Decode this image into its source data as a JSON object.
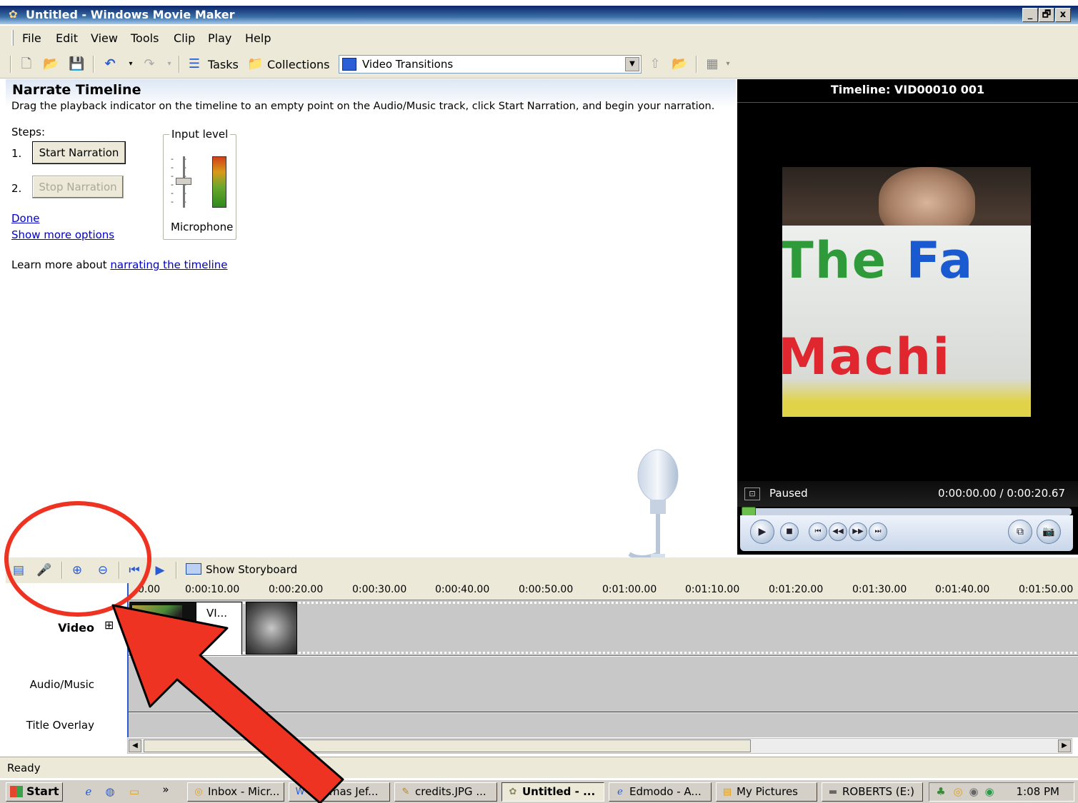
{
  "window": {
    "title": "Untitled - Windows Movie Maker",
    "controls": [
      "_",
      "🗗",
      "x"
    ]
  },
  "menu": [
    "File",
    "Edit",
    "View",
    "Tools",
    "Clip",
    "Play",
    "Help"
  ],
  "toolbar": {
    "tasks_label": "Tasks",
    "collections_label": "Collections",
    "dropdown_value": "Video Transitions"
  },
  "task_pane": {
    "title": "Narrate Timeline",
    "description": "Drag the playback indicator on the timeline to an empty point on the Audio/Music track, click Start Narration, and begin your narration.",
    "steps_label": "Steps:",
    "step1_num": "1.",
    "step1_button": "Start Narration",
    "step2_num": "2.",
    "step2_button": "Stop Narration",
    "done_link": "Done",
    "more_options_link": "Show more options",
    "learn_more_text": "Learn more about ",
    "learn_more_link": "narrating the timeline",
    "input_level_label": "Input level",
    "microphone_label": "Microphone"
  },
  "preview": {
    "title": "Timeline: VID00010 001",
    "sign_line1_a": "The ",
    "sign_line1_b": "Fa",
    "sign_line2": "Machi",
    "status": "Paused",
    "time": "0:00:00.00 / 0:00:20.67",
    "progress": 0
  },
  "timeline": {
    "show_storyboard": "Show Storyboard",
    "ruler_ticks": [
      "0.00",
      "0:00:10.00",
      "0:00:20.00",
      "0:00:30.00",
      "0:00:40.00",
      "0:00:50.00",
      "0:01:00.00",
      "0:01:10.00",
      "0:01:20.00",
      "0:01:30.00",
      "0:01:40.00",
      "0:01:50.00"
    ],
    "tracks": {
      "video": "Video",
      "video_expand": "⊞",
      "audio": "Audio/Music",
      "title_overlay": "Title Overlay"
    },
    "clip1_transition_label": "VI..."
  },
  "status_bar": {
    "text": "Ready"
  },
  "taskbar": {
    "start": "Start",
    "chevron": "»",
    "tasks": [
      {
        "label": "Inbox - Micr...",
        "icon": "outlook-icon"
      },
      {
        "label": "Thomas Jef...",
        "icon": "word-icon"
      },
      {
        "label": "credits.JPG ...",
        "icon": "image-icon"
      },
      {
        "label": "Untitled - ...",
        "icon": "moviemaker-icon"
      },
      {
        "label": "Edmodo - A...",
        "icon": "ie-icon"
      },
      {
        "label": "My Pictures",
        "icon": "folder-icon"
      },
      {
        "label": "ROBERTS (E:)",
        "icon": "drive-icon"
      }
    ],
    "clock": "1:08 PM"
  },
  "colors": {
    "annotation_red": "#ee3322",
    "link_blue": "#0000cc",
    "title_bar": "#0a246a"
  }
}
